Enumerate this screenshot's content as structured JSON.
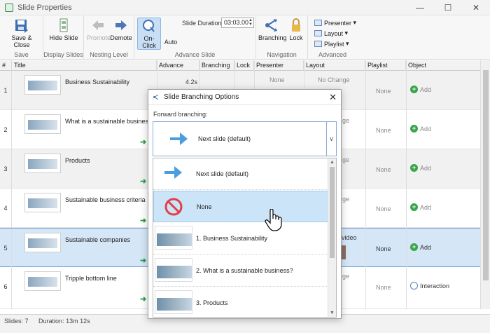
{
  "window": {
    "title": "Slide Properties"
  },
  "ribbon": {
    "save_close": "Save & Close",
    "save_group": "Save",
    "hide_slide": "Hide Slide",
    "display_group": "Display Slides",
    "promote": "Promote",
    "demote": "Demote",
    "nesting_group": "Nesting Level",
    "on_click": "On-Click",
    "auto": "Auto",
    "duration_label": "Slide Duration:",
    "duration_value": "03:03.00",
    "advance_group": "Advance Slide",
    "branching": "Branching",
    "lock": "Lock",
    "navigation_group": "Navigation",
    "presenter": "Presenter",
    "layout": "Layout",
    "playlist": "Playlist",
    "advanced_group": "Advanced"
  },
  "grid": {
    "headers": [
      "#",
      "Title",
      "Advance",
      "Branching",
      "Lock",
      "Presenter",
      "Layout",
      "Playlist",
      "Object"
    ],
    "rows": [
      {
        "num": "1",
        "title": "Business Sustainability",
        "advance": "4.2s",
        "presenter": "None",
        "layout": "No Change",
        "playlist": "None",
        "object": "Add"
      },
      {
        "num": "2",
        "title": "What is a sustainable business?",
        "advance": "",
        "presenter": "",
        "layout": "ge",
        "playlist": "None",
        "object": "Add"
      },
      {
        "num": "3",
        "title": "Products",
        "advance": "",
        "presenter": "",
        "layout": "ge",
        "playlist": "None",
        "object": "Add"
      },
      {
        "num": "4",
        "title": "Sustainable business criteria",
        "advance": "",
        "presenter": "",
        "layout": "ge",
        "playlist": "None",
        "object": "Add"
      },
      {
        "num": "5",
        "title": "Sustainable companies",
        "advance": "",
        "presenter": "",
        "layout": "video",
        "playlist": "None",
        "object": "Add"
      },
      {
        "num": "6",
        "title": "Tripple bottom line",
        "advance": "",
        "presenter": "",
        "layout": "ge",
        "playlist": "None",
        "object": "Interaction"
      }
    ]
  },
  "status": {
    "slides": "Slides: 7",
    "duration": "Duration: 13m 12s"
  },
  "dialog": {
    "title": "Slide Branching Options",
    "forward_label": "Forward branching:",
    "selected": "Next slide (default)",
    "items": [
      "Next slide (default)",
      "None",
      "1. Business Sustainability",
      "2. What is a sustainable business?",
      "3. Products"
    ]
  },
  "colors": {
    "accent": "#4a9ee0",
    "selection": "#cce4f7",
    "green": "#3aa44a",
    "none_red": "#e0404a"
  }
}
